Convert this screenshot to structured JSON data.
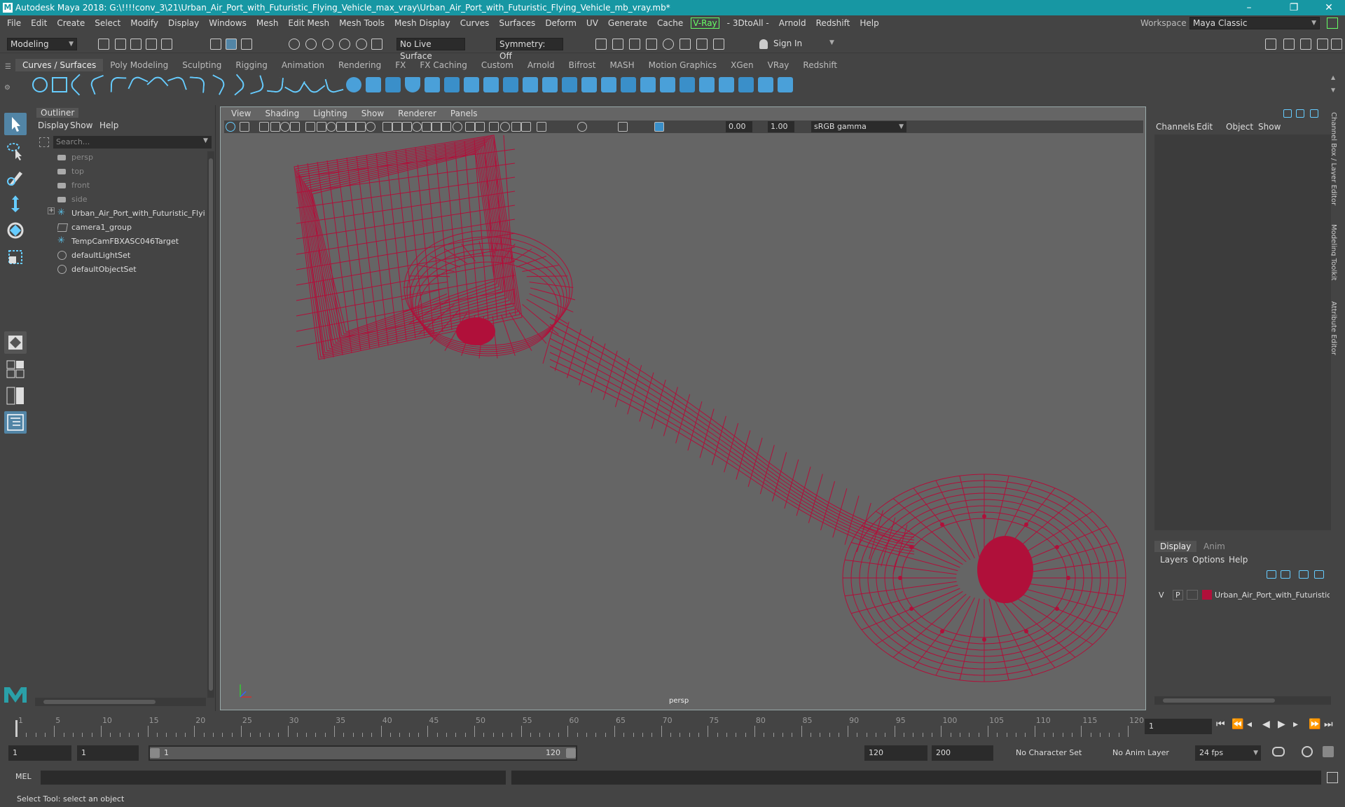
{
  "titlebar": {
    "title": "Autodesk Maya 2018: G:\\!!!!conv_3\\21\\Urban_Air_Port_with_Futuristic_Flying_Vehicle_max_vray\\Urban_Air_Port_with_Futuristic_Flying_Vehicle_mb_vray.mb*",
    "minimize": "–",
    "maximize": "❐",
    "close": "✕"
  },
  "menubar": {
    "items": [
      "File",
      "Edit",
      "Create",
      "Select",
      "Modify",
      "Display",
      "Windows",
      "Mesh",
      "Edit Mesh",
      "Mesh Tools",
      "Mesh Display",
      "Curves",
      "Surfaces",
      "Deform",
      "UV",
      "Generate",
      "Cache"
    ],
    "vray": "V-Ray",
    "items2": [
      "- 3DtoAll -",
      "Arnold",
      "Redshift",
      "Help"
    ],
    "workspace_label": "Workspace :",
    "workspace_value": "Maya Classic"
  },
  "statusline": {
    "mode": "Modeling",
    "live_surface": "No Live Surface",
    "symmetry": "Symmetry: Off",
    "sign_in": "Sign In"
  },
  "shelf": {
    "tabs": [
      "Curves / Surfaces",
      "Poly Modeling",
      "Sculpting",
      "Rigging",
      "Animation",
      "Rendering",
      "FX",
      "FX Caching",
      "Custom",
      "Arnold",
      "Bifrost",
      "MASH",
      "Motion Graphics",
      "XGen",
      "VRay",
      "Redshift"
    ],
    "active": 0
  },
  "outliner": {
    "title": "Outliner",
    "menu": [
      "Display",
      "Show",
      "Help"
    ],
    "search_placeholder": "Search...",
    "rows": [
      {
        "label": "persp",
        "icon": "camera-icon",
        "dim": true
      },
      {
        "label": "top",
        "icon": "camera-icon",
        "dim": true
      },
      {
        "label": "front",
        "icon": "camera-icon",
        "dim": true
      },
      {
        "label": "side",
        "icon": "camera-icon",
        "dim": true
      },
      {
        "label": "Urban_Air_Port_with_Futuristic_Flying",
        "icon": "joint-icon",
        "dim": false,
        "expand": "+"
      },
      {
        "label": "camera1_group",
        "icon": "group-icon",
        "dim": false
      },
      {
        "label": "TempCamFBXASC046Target",
        "icon": "joint-icon",
        "dim": false
      },
      {
        "label": "defaultLightSet",
        "icon": "set-icon",
        "dim": false
      },
      {
        "label": "defaultObjectSet",
        "icon": "set-icon",
        "dim": false
      }
    ]
  },
  "viewport": {
    "menu": [
      "View",
      "Shading",
      "Lighting",
      "Show",
      "Renderer",
      "Panels"
    ],
    "exposure": "0.00",
    "gamma": "1.00",
    "colorspace": "sRGB gamma",
    "camera_label": "persp",
    "wire_color": "#b0103a"
  },
  "channelbox": {
    "menu": [
      "Channels",
      "Edit",
      "Object",
      "Show"
    ],
    "side_tabs": [
      "Channel Box / Layer Editor",
      "Modeling Toolkit",
      "Attribute Editor"
    ]
  },
  "layers": {
    "tabs": [
      "Display",
      "Anim"
    ],
    "menu": [
      "Layers",
      "Options",
      "Help"
    ],
    "layer_v": "V",
    "layer_p": "P",
    "layer_name": "Urban_Air_Port_with_Futuristic",
    "layer_color": "#b0103a"
  },
  "timeline": {
    "ticks": [
      "1",
      "5",
      "10",
      "15",
      "20",
      "25",
      "30",
      "35",
      "40",
      "45",
      "50",
      "55",
      "60",
      "65",
      "70",
      "75",
      "80",
      "85",
      "90",
      "95",
      "100",
      "105",
      "110",
      "115",
      "120"
    ],
    "current_frame": "1"
  },
  "range": {
    "start": "1",
    "playback_start": "1",
    "slider_start": "1",
    "slider_end": "120",
    "playback_end": "120",
    "end": "200",
    "character_set": "No Character Set",
    "anim_layer": "No Anim Layer",
    "fps": "24 fps"
  },
  "cmdline": {
    "label": "MEL"
  },
  "helpline": {
    "text": "Select Tool: select an object"
  }
}
